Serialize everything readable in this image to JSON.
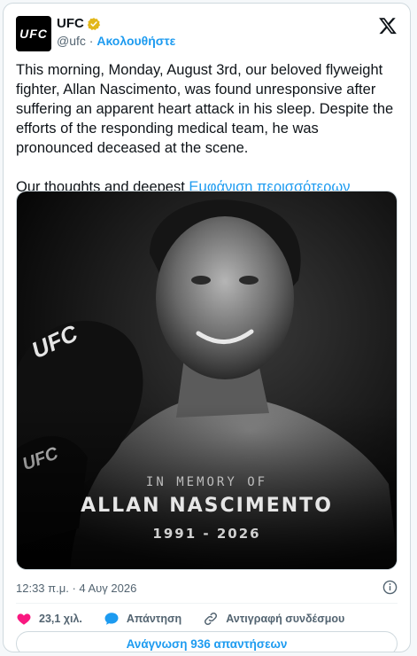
{
  "author": {
    "name": "UFC",
    "handle": "@ufc",
    "separator": "·",
    "follow_label": "Ακολουθήστε",
    "avatar_text": "UFC"
  },
  "tweet": {
    "paragraph1": "This morning, Monday, August 3rd, our beloved flyweight fighter, Allan Nascimento, was found unresponsive after suffering an apparent heart attack in his sleep. Despite the efforts of the responding medical team, he was pronounced deceased at the scene.",
    "paragraph2": "Our thoughts and deepest",
    "show_more": "Εμφάνιση περισσότερων"
  },
  "media": {
    "line1": "IN MEMORY OF",
    "line2": "ALLAN NASCIMENTO",
    "line3": "1991 - 2026",
    "glove_text": "UFC"
  },
  "meta": {
    "timestamp": "12:33 π.μ. · 4 Αυγ 2026"
  },
  "actions": {
    "likes": "23,1 χιλ.",
    "reply": "Απάντηση",
    "copy_link": "Αντιγραφή συνδέσμου"
  },
  "read_replies": "Ανάγνωση 936 απαντήσεων",
  "colors": {
    "accent": "#1d9bf0",
    "like": "#f91880",
    "verified": "#e2b719"
  }
}
